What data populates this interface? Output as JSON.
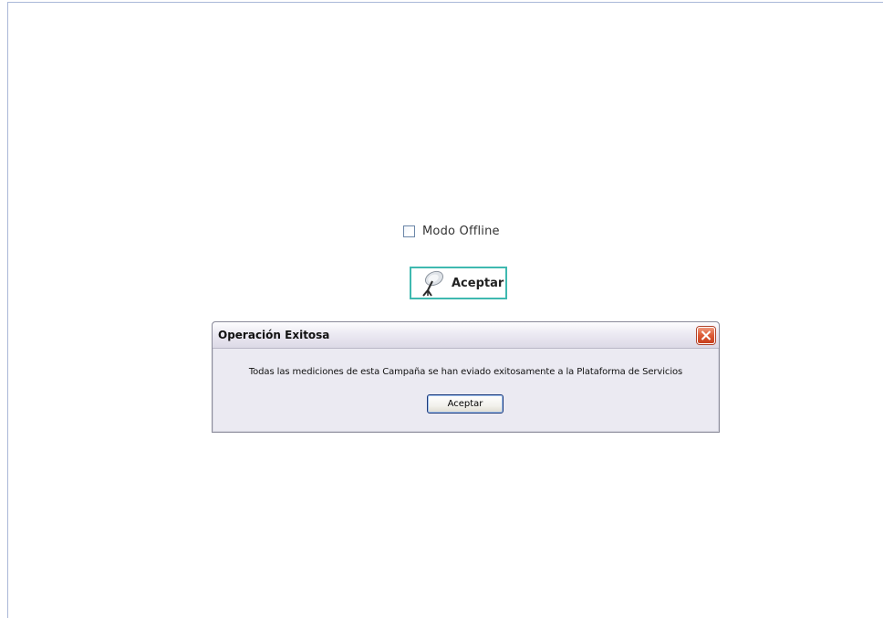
{
  "form": {
    "offline_checkbox": {
      "label": "Modo Offline",
      "checked": false
    },
    "accept_button": {
      "label": "Aceptar",
      "icon": "satellite-dish-icon"
    }
  },
  "dialog": {
    "title": "Operación Exitosa",
    "message": "Todas las mediciones de esta Campaña se han eviado exitosamente a la Plataforma de Servicios",
    "ok_label": "Aceptar",
    "close_icon": "close-icon"
  },
  "colors": {
    "accent_border": "#3fb9b0",
    "close_button": "#dc5a35",
    "dialog_background": "#ebeaf2"
  }
}
